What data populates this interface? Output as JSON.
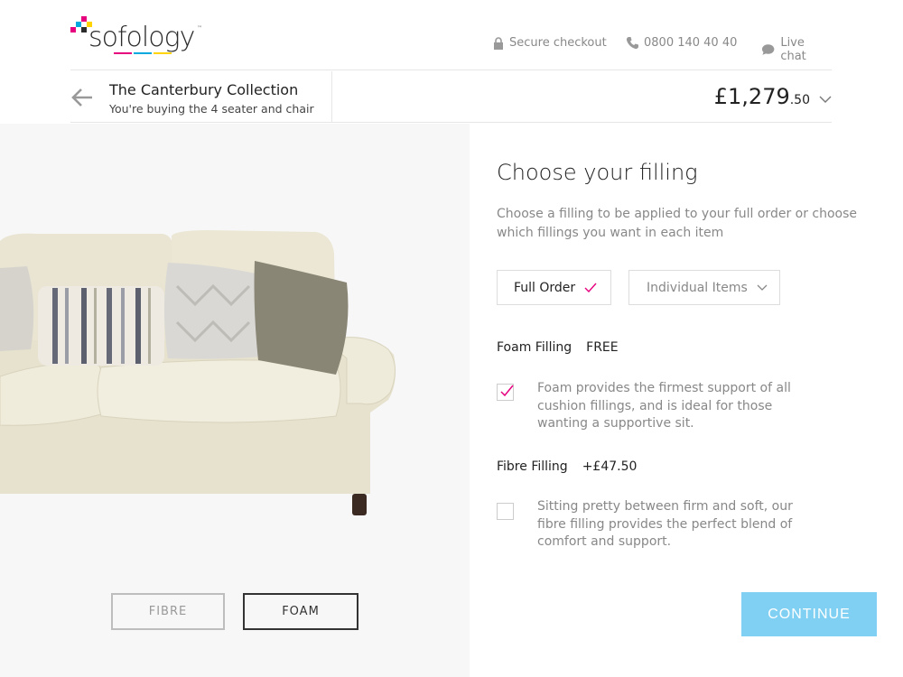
{
  "brand": {
    "name": "sofology",
    "tm": "™",
    "colors": {
      "pink": "#e6007e",
      "cyan": "#00a8e0",
      "yellow": "#ffd400",
      "magenta": "#e6007e"
    }
  },
  "header": {
    "secure_checkout": "Secure checkout",
    "phone": "0800 140 40 40",
    "live_chat": "Live chat"
  },
  "product": {
    "title": "The Canterbury Collection",
    "subtitle": "You're buying the 4 seater and chair",
    "price_main": "£1,279",
    "price_pence": ".50"
  },
  "preview": {
    "fibre_label": "FIBRE",
    "foam_label": "FOAM",
    "selected": "FOAM"
  },
  "filling": {
    "heading": "Choose your filling",
    "intro": "Choose a filling to be applied to your full order or choose which fillings you want in each item",
    "full_order_label": "Full Order",
    "individual_items_label": "Individual Items",
    "options": [
      {
        "name": "Foam Filling",
        "price": "FREE",
        "checked": true,
        "description": "Foam provides the firmest support of all cushion fillings, and is ideal for those wanting a supportive sit."
      },
      {
        "name": "Fibre Filling",
        "price": "+£47.50",
        "checked": false,
        "description": "Sitting pretty between firm and soft, our fibre filling provides the perfect blend of comfort and support."
      }
    ]
  },
  "continue_label": "CONTINUE",
  "accent": "#7fd0f2",
  "check_color": "#e6007e"
}
